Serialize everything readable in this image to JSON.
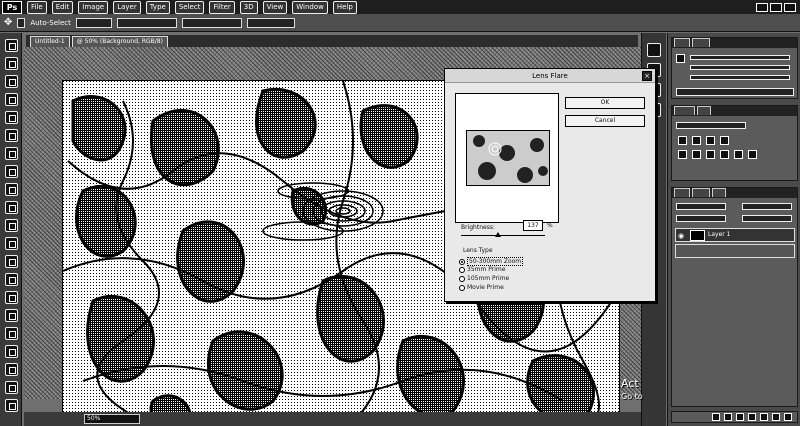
{
  "app": {
    "logo": "Ps"
  },
  "menu": [
    "File",
    "Edit",
    "Image",
    "Layer",
    "Type",
    "Select",
    "Filter",
    "3D",
    "View",
    "Window",
    "Help"
  ],
  "options_bar": {
    "labels": [
      "Auto-Select"
    ]
  },
  "doc_tabs": [
    "Untitled-1",
    "@ 50% (Background, RGB/8)"
  ],
  "zoom": "50%",
  "panels": {
    "layers": {
      "layer_name": "Layer 1"
    }
  },
  "dialog": {
    "title": "Lens Flare",
    "ok_label": "OK",
    "cancel_label": "Cancel",
    "brightness_label": "Brightness:",
    "brightness_value": "137",
    "brightness_unit": "%",
    "brightness_level_percent": 137,
    "lens_type_label": "Lens Type",
    "lens_types": [
      "50-300mm Zoom",
      "35mm Prime",
      "105mm Prime",
      "Movie Prime"
    ],
    "selected_lens_index": 0
  },
  "activation": {
    "line1": "Act",
    "line2": "Go to"
  },
  "colors": {
    "chrome": "#3a3a3a",
    "dialog_bg": "#e9e9e9",
    "menubar": "#1e1e1e"
  },
  "icons": [
    "close-icon",
    "eye-icon",
    "move-tool-icon"
  ]
}
